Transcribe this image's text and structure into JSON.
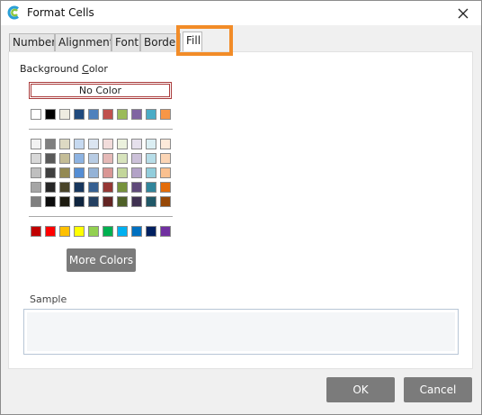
{
  "window": {
    "title": "Format Cells",
    "app_icon": "app-logo-icon"
  },
  "tabs": [
    {
      "label": "Number"
    },
    {
      "label": "Alignment"
    },
    {
      "label": "Font"
    },
    {
      "label": "Borders"
    },
    {
      "label": "Fill",
      "active": true
    }
  ],
  "fill": {
    "background_label_prefix": "Background ",
    "background_label_underlined": "C",
    "background_label_suffix": "olor",
    "no_color_label": "No Color",
    "theme_top_row": [
      "#ffffff",
      "#000000",
      "#eeece1",
      "#1f497d",
      "#4f81bd",
      "#c0504d",
      "#9bbb59",
      "#8064a2",
      "#4bacc6",
      "#f79646"
    ],
    "theme_shades": [
      [
        "#f2f2f2",
        "#7f7f7f",
        "#ddd9c3",
        "#c6d9f0",
        "#dbe5f1",
        "#f2dcdb",
        "#ebf1dd",
        "#e5e0ec",
        "#dbeef3",
        "#fdeada"
      ],
      [
        "#d8d8d8",
        "#595959",
        "#c4bd97",
        "#8db3e2",
        "#b8cce4",
        "#e5b9b7",
        "#d7e3bc",
        "#ccc1d9",
        "#b7dde8",
        "#fbd5b5"
      ],
      [
        "#bfbfbf",
        "#3f3f3f",
        "#938953",
        "#548dd4",
        "#95b3d7",
        "#d99694",
        "#c3d69b",
        "#b2a2c7",
        "#92cddc",
        "#fac08f"
      ],
      [
        "#a5a5a5",
        "#262626",
        "#494429",
        "#17365d",
        "#366092",
        "#953734",
        "#76923c",
        "#5f497a",
        "#31859b",
        "#e36c09"
      ],
      [
        "#7f7f7f",
        "#0c0c0c",
        "#1d1b10",
        "#0f243e",
        "#244061",
        "#632423",
        "#4f6128",
        "#3f3151",
        "#205867",
        "#974806"
      ]
    ],
    "standard_colors": [
      "#c00000",
      "#ff0000",
      "#ffc000",
      "#ffff00",
      "#92d050",
      "#00b050",
      "#00b0f0",
      "#0070c0",
      "#002060",
      "#7030a0"
    ],
    "more_colors_label": "More Colors",
    "sample_label": "Sample"
  },
  "buttons": {
    "ok": "OK",
    "cancel": "Cancel"
  },
  "highlight_color": "#f28c28"
}
